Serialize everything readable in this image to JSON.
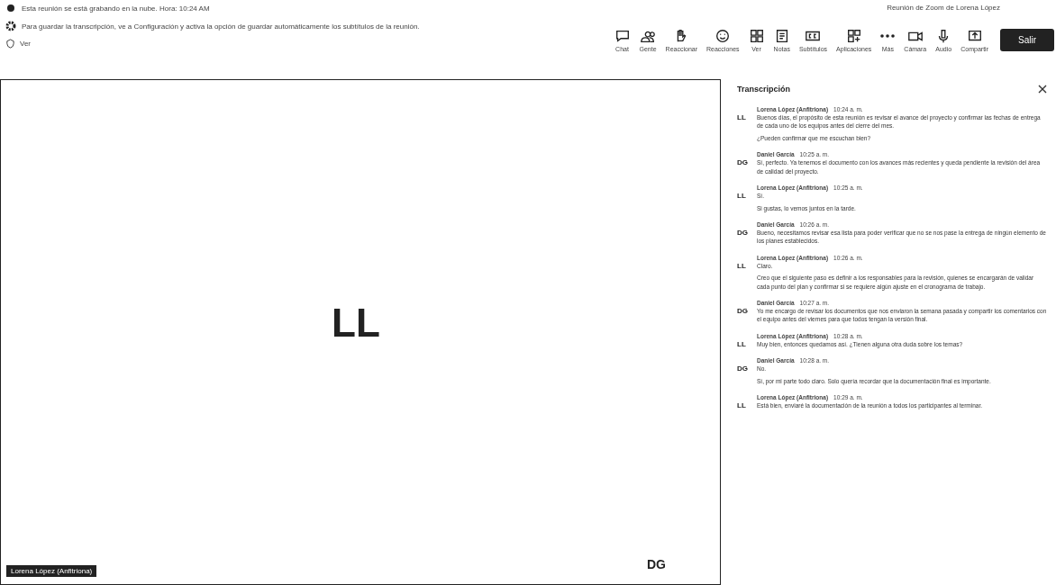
{
  "notices": [
    {
      "kind": "record",
      "text": "Esta reunión se está grabando en la nube. Hora: 10:24 AM"
    },
    {
      "kind": "settings",
      "text": "Para guardar la transcripción, ve a Configuración y activa la opción de guardar automáticamente los subtítulos de la reunión."
    }
  ],
  "meeting_title": "Reunión de Zoom de Lorena López",
  "view_controls": {
    "label": "Ver"
  },
  "toolbar": [
    {
      "kind": "chat",
      "label": "Chat"
    },
    {
      "kind": "people",
      "label": "Gente"
    },
    {
      "kind": "hand",
      "label": "Reaccionar"
    },
    {
      "kind": "smile",
      "label": "Reacciones"
    },
    {
      "kind": "grid",
      "label": "Ver"
    },
    {
      "kind": "notes",
      "label": "Notas"
    },
    {
      "kind": "cc",
      "label": "Subtítulos"
    },
    {
      "kind": "apps",
      "label": "Aplicaciones"
    },
    {
      "kind": "more",
      "label": "Más"
    },
    {
      "kind": "camera",
      "label": "Cámara"
    },
    {
      "kind": "mic",
      "label": "Audio"
    },
    {
      "kind": "share",
      "label": "Compartir"
    }
  ],
  "leave_button": "Salir",
  "stage": {
    "speaker_initials": "LL",
    "self_initials": "DG",
    "name_tag": "Lorena López (Anfitriona)"
  },
  "transcript": {
    "title": "Transcripción",
    "entries": [
      {
        "initials": "LL",
        "speaker": "Lorena López (Anfitriona)",
        "time": "10:24 a. m.",
        "paragraphs": [
          "Buenos días, el propósito de esta reunión es revisar el avance del proyecto y confirmar las fechas de entrega de cada uno de los equipos antes del cierre del mes.",
          "¿Pueden confirmar que me escuchan bien?"
        ]
      },
      {
        "initials": "DG",
        "speaker": "Daniel García",
        "time": "10:25 a. m.",
        "paragraphs": [
          "Sí, perfecto. Ya tenemos el documento con los avances más recientes y queda pendiente la revisión del área de calidad del proyecto."
        ]
      },
      {
        "initials": "LL",
        "speaker": "Lorena López (Anfitriona)",
        "time": "10:25 a. m.",
        "paragraphs": [
          "Sí.",
          "Si gustas, lo vemos juntos en la tarde."
        ]
      },
      {
        "initials": "DG",
        "speaker": "Daniel García",
        "time": "10:26 a. m.",
        "paragraphs": [
          "Bueno, necesitamos revisar esa lista para poder verificar que no se nos pase la entrega de ningún elemento de los planes establecidos."
        ]
      },
      {
        "initials": "LL",
        "speaker": "Lorena López (Anfitriona)",
        "time": "10:26 a. m.",
        "paragraphs": [
          "Claro.",
          "Creo que el siguiente paso es definir a los responsables para la revisión, quienes se encargarán de validar cada punto del plan y confirmar si se requiere algún ajuste en el cronograma de trabajo."
        ]
      },
      {
        "initials": "DG",
        "speaker": "Daniel García",
        "time": "10:27 a. m.",
        "paragraphs": [
          "Yo me encargo de revisar los documentos que nos enviaron la semana pasada y compartir los comentarios con el equipo antes del viernes para que todos tengan la versión final."
        ]
      },
      {
        "initials": "LL",
        "speaker": "Lorena López (Anfitriona)",
        "time": "10:28 a. m.",
        "paragraphs": [
          "Muy bien, entonces quedamos así. ¿Tienen alguna otra duda sobre los temas?"
        ]
      },
      {
        "initials": "DG",
        "speaker": "Daniel García",
        "time": "10:28 a. m.",
        "paragraphs": [
          "No.",
          "Sí, por mi parte todo claro. Solo quería recordar que la documentación final es importante."
        ]
      },
      {
        "initials": "LL",
        "speaker": "Lorena López (Anfitriona)",
        "time": "10:29 a. m.",
        "paragraphs": [
          "Está bien, enviaré la documentación de la reunión a todos los participantes al terminar."
        ]
      }
    ]
  }
}
